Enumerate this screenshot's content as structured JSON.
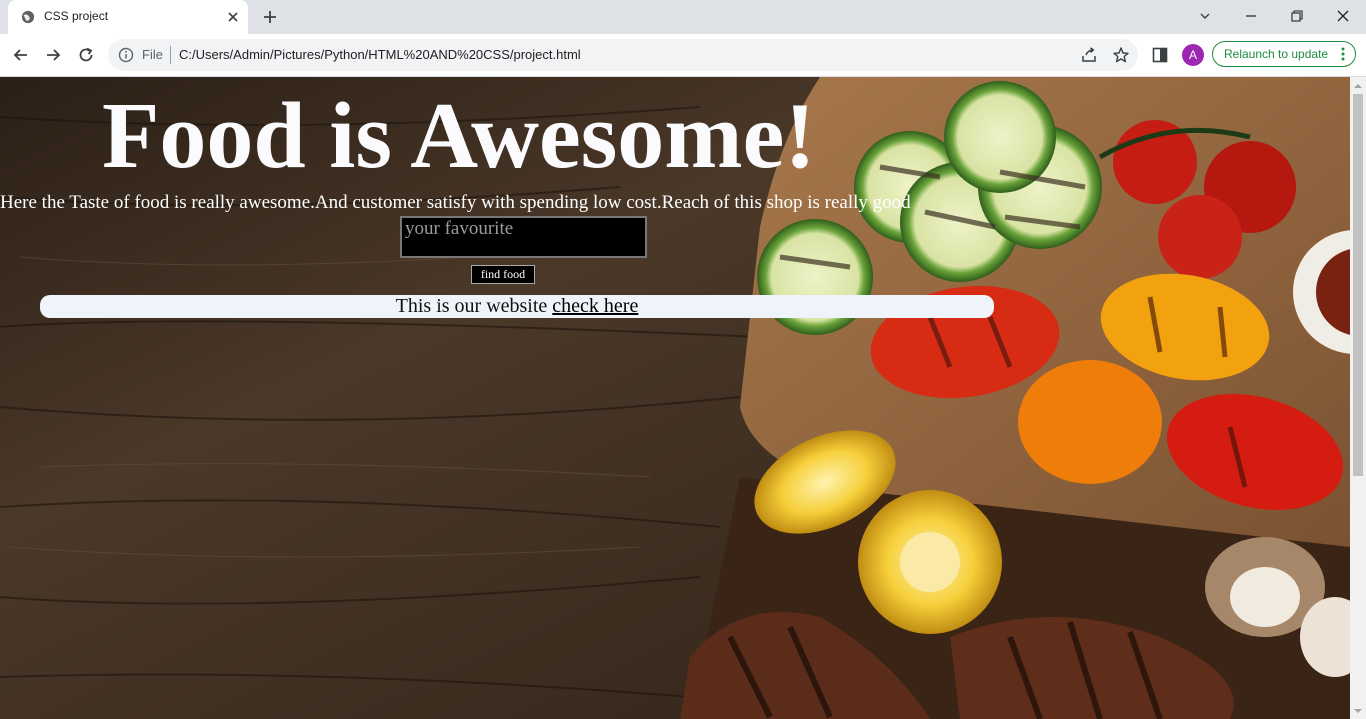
{
  "browser": {
    "tab_title": "CSS project",
    "url_scheme": "File",
    "url": "C:/Users/Admin/Pictures/Python/HTML%20AND%20CSS/project.html",
    "avatar_letter": "A",
    "relaunch_label": "Relaunch to update"
  },
  "page": {
    "title": "Food is Awesome!",
    "tagline": "Here the Taste of food is really awesome.And customer satisfy with spending low cost.Reach of this shop is really good",
    "search_placeholder": "your favourite",
    "search_value": "",
    "button_label": "find food",
    "info_text": "This is our website ",
    "info_link": "check here"
  },
  "colors": {
    "relaunch_green": "#1e8e3e",
    "avatar_purple": "#9c27b0",
    "info_bar_bg": "#eef4fa"
  }
}
